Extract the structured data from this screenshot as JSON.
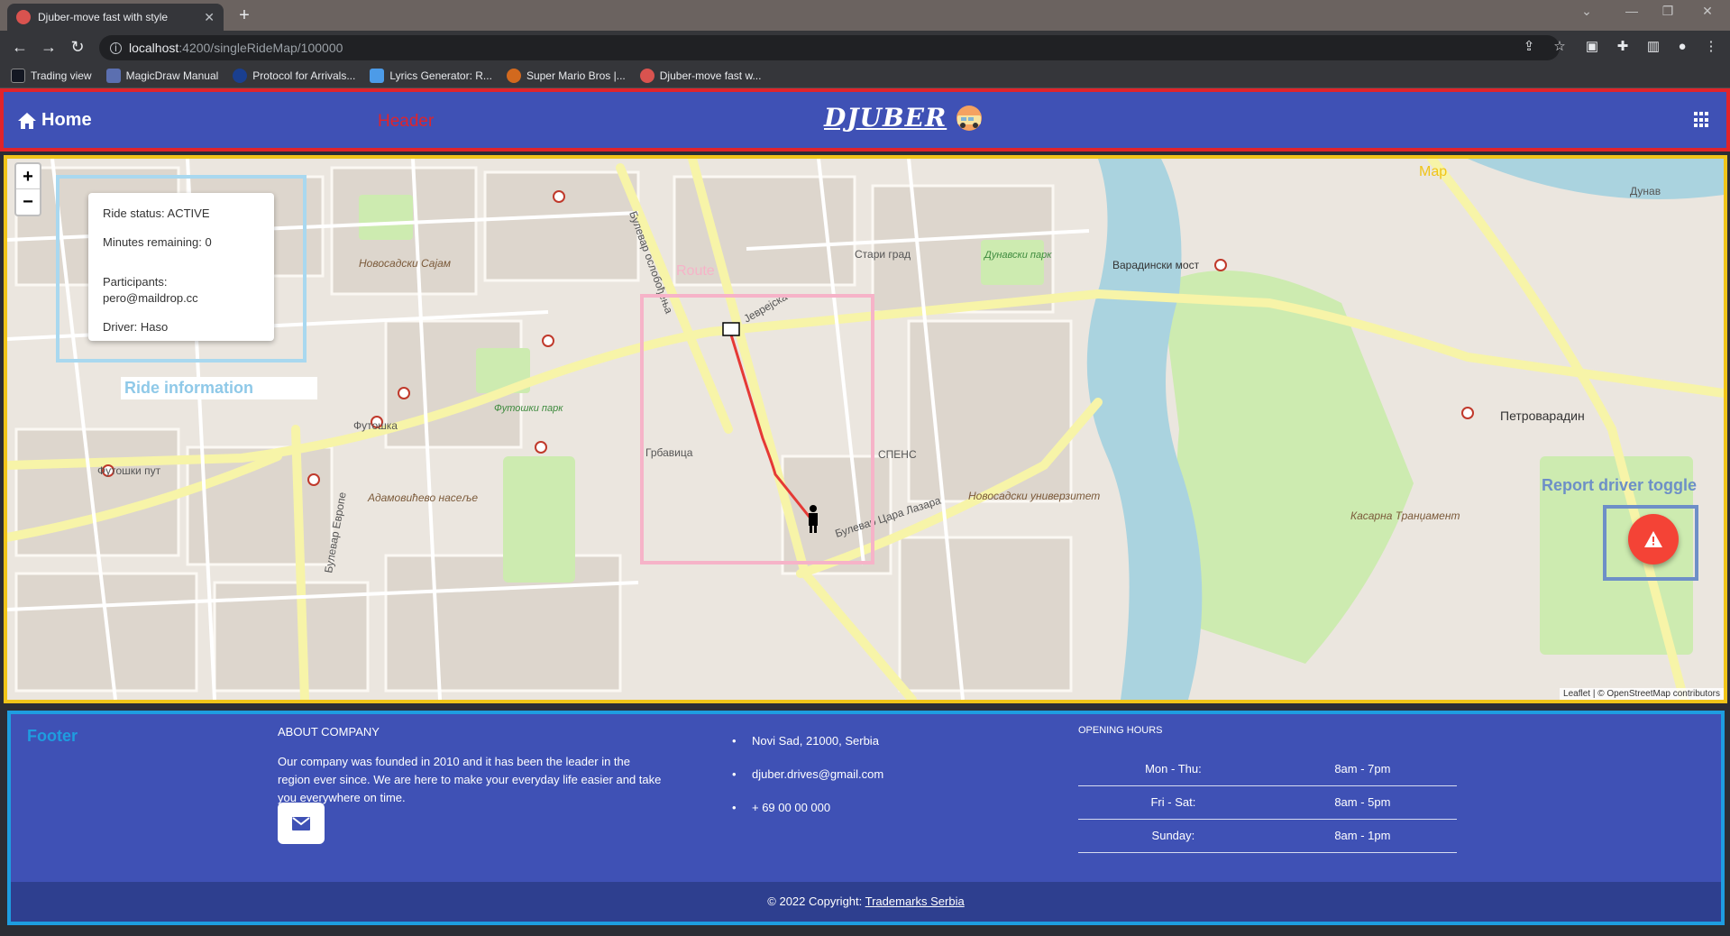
{
  "browser": {
    "tab_title": "Djuber-move fast with style",
    "tab_close": "✕",
    "new_tab": "+",
    "url_host": "localhost",
    "url_path": ":4200/singleRideMap/100000",
    "bookmarks": [
      {
        "label": "Trading view",
        "color": "#131722"
      },
      {
        "label": "MagicDraw Manual",
        "color": "#5b6fb0"
      },
      {
        "label": "Protocol for Arrivals...",
        "color": "#1a3f8f"
      },
      {
        "label": "Lyrics Generator: R...",
        "color": "#4c9be8"
      },
      {
        "label": "Super Mario Bros |...",
        "color": "#d2691e"
      },
      {
        "label": "Djuber-move fast w...",
        "color": "#d9534f"
      }
    ]
  },
  "header": {
    "home_label": "Home",
    "annotation_label": "Header",
    "logo_text": "DJUBER"
  },
  "map": {
    "annotation_label": "Map",
    "zoom_in": "+",
    "zoom_out": "−",
    "route_label": "Route",
    "ride_info_label": "Ride information",
    "report_label": "Report driver toggle",
    "attribution": "Leaflet | © OpenStreetMap contributors",
    "ride": {
      "status": "Ride status: ACTIVE",
      "minutes": "Minutes remaining: 0",
      "participants_label": "Participants:",
      "participant": "pero@maildrop.cc",
      "driver": "Driver: Haso"
    },
    "place_labels": {
      "bulevar_oslobodjenja": "Булевар ослобођења",
      "futoska": "Футошка",
      "futoski_put": "Футошки пут",
      "jevrejska": "Јеврејска",
      "stari_grad": "Стари град",
      "grbavica": "Грбавица",
      "spens": "СПЕНС",
      "petrovaradin": "Петроварадин",
      "dunav": "Дунав",
      "novosadski_sajam": "Новосадски Сајам",
      "adamovicevo": "Адамовићево насеље",
      "futoski_park": "Футошки парк",
      "dunavski_park": "Дунавски парк",
      "varadinski_most": "Варадински мост",
      "bulevar_cara_lazara": "Булевар Цара Лазара",
      "bulevar_evrope": "Булевар Европе",
      "univerzitet": "Новосадски универзитет",
      "kasarna": "Касарна Трaнџамент"
    }
  },
  "footer": {
    "annotation_label": "Footer",
    "about_title": "ABOUT COMPANY",
    "about_text": "Our company was founded in 2010 and it has been the leader in the region ever since. We are here to make your everyday life easier and take you everywhere on time.",
    "contact": [
      "Novi Sad, 21000, Serbia",
      "djuber.drives@gmail.com",
      "+ 69 00 00 000"
    ],
    "hours_title": "OPENING HOURS",
    "hours": [
      {
        "day": "Mon - Thu:",
        "time": "8am - 7pm"
      },
      {
        "day": "Fri - Sat:",
        "time": "8am - 5pm"
      },
      {
        "day": "Sunday:",
        "time": "8am - 1pm"
      }
    ],
    "copyright_prefix": "© 2022 Copyright: ",
    "copyright_link": "Trademarks Serbia"
  },
  "colors": {
    "primary": "#3f51b5",
    "header_border": "#e0242b",
    "map_border": "#f0c419",
    "footer_border": "#1e9de0",
    "fab": "#f44336",
    "route": "#e53935"
  }
}
